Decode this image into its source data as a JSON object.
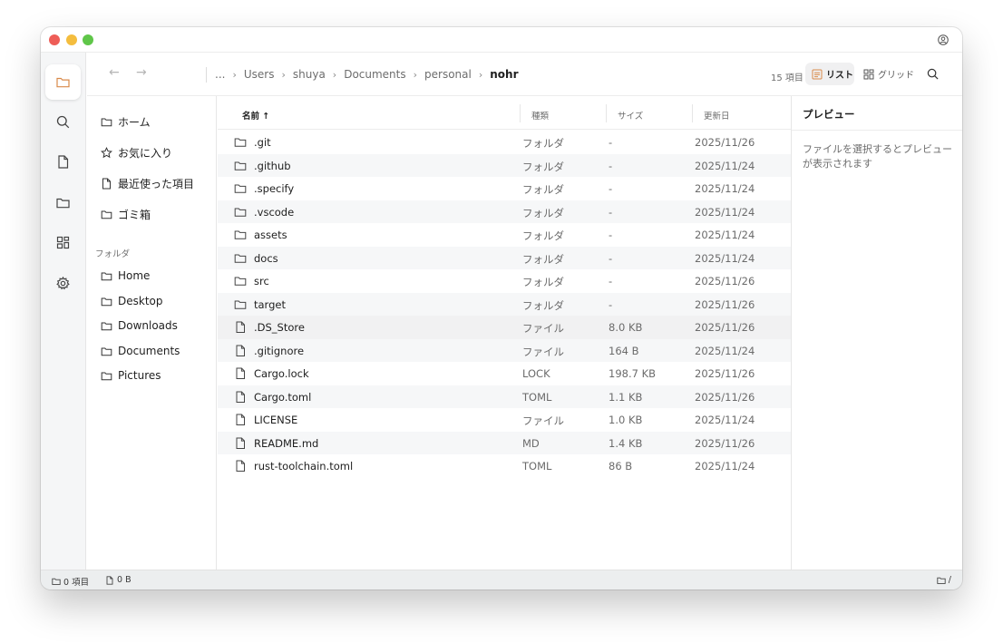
{
  "toolbar": {
    "back": "←",
    "forward": "→",
    "breadcrumbs": [
      "...",
      "Users",
      "shuya",
      "Documents",
      "personal",
      "nohr"
    ],
    "item_count": "15 項目",
    "list_view": "リスト",
    "grid_view": "グリッド"
  },
  "sidebar": {
    "quick": [
      "ホーム",
      "お気に入り",
      "最近使った項目",
      "ゴミ箱"
    ],
    "folders_heading": "フォルダ",
    "folders": [
      "Home",
      "Desktop",
      "Downloads",
      "Documents",
      "Pictures"
    ]
  },
  "columns": {
    "name": "名前 ↑",
    "kind": "種類",
    "size": "サイズ",
    "modified": "更新日"
  },
  "files": [
    {
      "name": ".git",
      "kind": "フォルダ",
      "size": "-",
      "modified": "2025/11/26",
      "icon": "folder-icon"
    },
    {
      "name": ".github",
      "kind": "フォルダ",
      "size": "-",
      "modified": "2025/11/24",
      "icon": "folder-icon"
    },
    {
      "name": ".specify",
      "kind": "フォルダ",
      "size": "-",
      "modified": "2025/11/24",
      "icon": "folder-icon"
    },
    {
      "name": ".vscode",
      "kind": "フォルダ",
      "size": "-",
      "modified": "2025/11/24",
      "icon": "folder-icon"
    },
    {
      "name": "assets",
      "kind": "フォルダ",
      "size": "-",
      "modified": "2025/11/24",
      "icon": "folder-icon"
    },
    {
      "name": "docs",
      "kind": "フォルダ",
      "size": "-",
      "modified": "2025/11/24",
      "icon": "folder-icon"
    },
    {
      "name": "src",
      "kind": "フォルダ",
      "size": "-",
      "modified": "2025/11/26",
      "icon": "folder-icon"
    },
    {
      "name": "target",
      "kind": "フォルダ",
      "size": "-",
      "modified": "2025/11/26",
      "icon": "folder-icon"
    },
    {
      "name": ".DS_Store",
      "kind": "ファイル",
      "size": "8.0 KB",
      "modified": "2025/11/26",
      "icon": "file-icon"
    },
    {
      "name": ".gitignore",
      "kind": "ファイル",
      "size": "164 B",
      "modified": "2025/11/24",
      "icon": "file-icon"
    },
    {
      "name": "Cargo.lock",
      "kind": "LOCK",
      "size": "198.7 KB",
      "modified": "2025/11/26",
      "icon": "file-icon"
    },
    {
      "name": "Cargo.toml",
      "kind": "TOML",
      "size": "1.1 KB",
      "modified": "2025/11/26",
      "icon": "file-icon"
    },
    {
      "name": "LICENSE",
      "kind": "ファイル",
      "size": "1.0 KB",
      "modified": "2025/11/24",
      "icon": "file-icon"
    },
    {
      "name": "README.md",
      "kind": "MD",
      "size": "1.4 KB",
      "modified": "2025/11/26",
      "icon": "file-icon"
    },
    {
      "name": "rust-toolchain.toml",
      "kind": "TOML",
      "size": "86 B",
      "modified": "2025/11/24",
      "icon": "file-icon"
    }
  ],
  "preview": {
    "title": "プレビュー",
    "message": "ファイルを選択するとプレビューが表示されます"
  },
  "status": {
    "selected_items": "0 項目",
    "selected_size": "0 B",
    "path": "/"
  },
  "colors": {
    "accent": "#d98a4a",
    "close": "#ee5d57",
    "minimize": "#f4bd3e",
    "zoom": "#5fc649"
  }
}
